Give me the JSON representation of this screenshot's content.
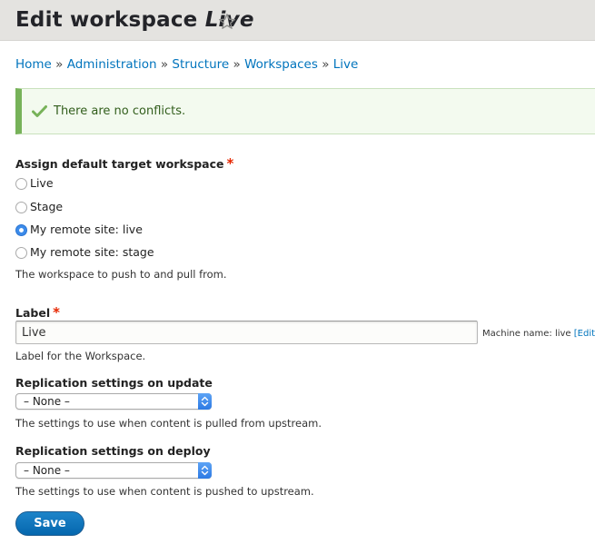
{
  "header": {
    "title_prefix": "Edit workspace",
    "title_name": "Live",
    "shortcut_icon": "star-outline-icon"
  },
  "breadcrumb": {
    "items": [
      "Home",
      "Administration",
      "Structure",
      "Workspaces",
      "Live"
    ],
    "separator": "»"
  },
  "status_message": {
    "icon": "checkmark-icon",
    "text": "There are no conflicts.",
    "color": "#77b259"
  },
  "target_workspace": {
    "label": "Assign default target workspace",
    "required_marker": "*",
    "options": [
      "Live",
      "Stage",
      "My remote site: live",
      "My remote site: stage"
    ],
    "selected": "My remote site: live",
    "description": "The workspace to push to and pull from."
  },
  "label_field": {
    "label": "Label",
    "required_marker": "*",
    "value": "Live",
    "machine_name_prefix": "Machine name: live",
    "machine_name_edit": "[Edit]",
    "description": "Label for the Workspace."
  },
  "replication_update": {
    "label": "Replication settings on update",
    "value": "– None –",
    "description": "The settings to use when content is pulled from upstream."
  },
  "replication_deploy": {
    "label": "Replication settings on deploy",
    "value": "– None –",
    "description": "The settings to use when content is pushed to upstream."
  },
  "actions": {
    "save_label": "Save"
  },
  "colors": {
    "link": "#0074bd",
    "required": "#e62600",
    "primary_button": "#0567ae",
    "radio_selected": "#3c8bea"
  }
}
